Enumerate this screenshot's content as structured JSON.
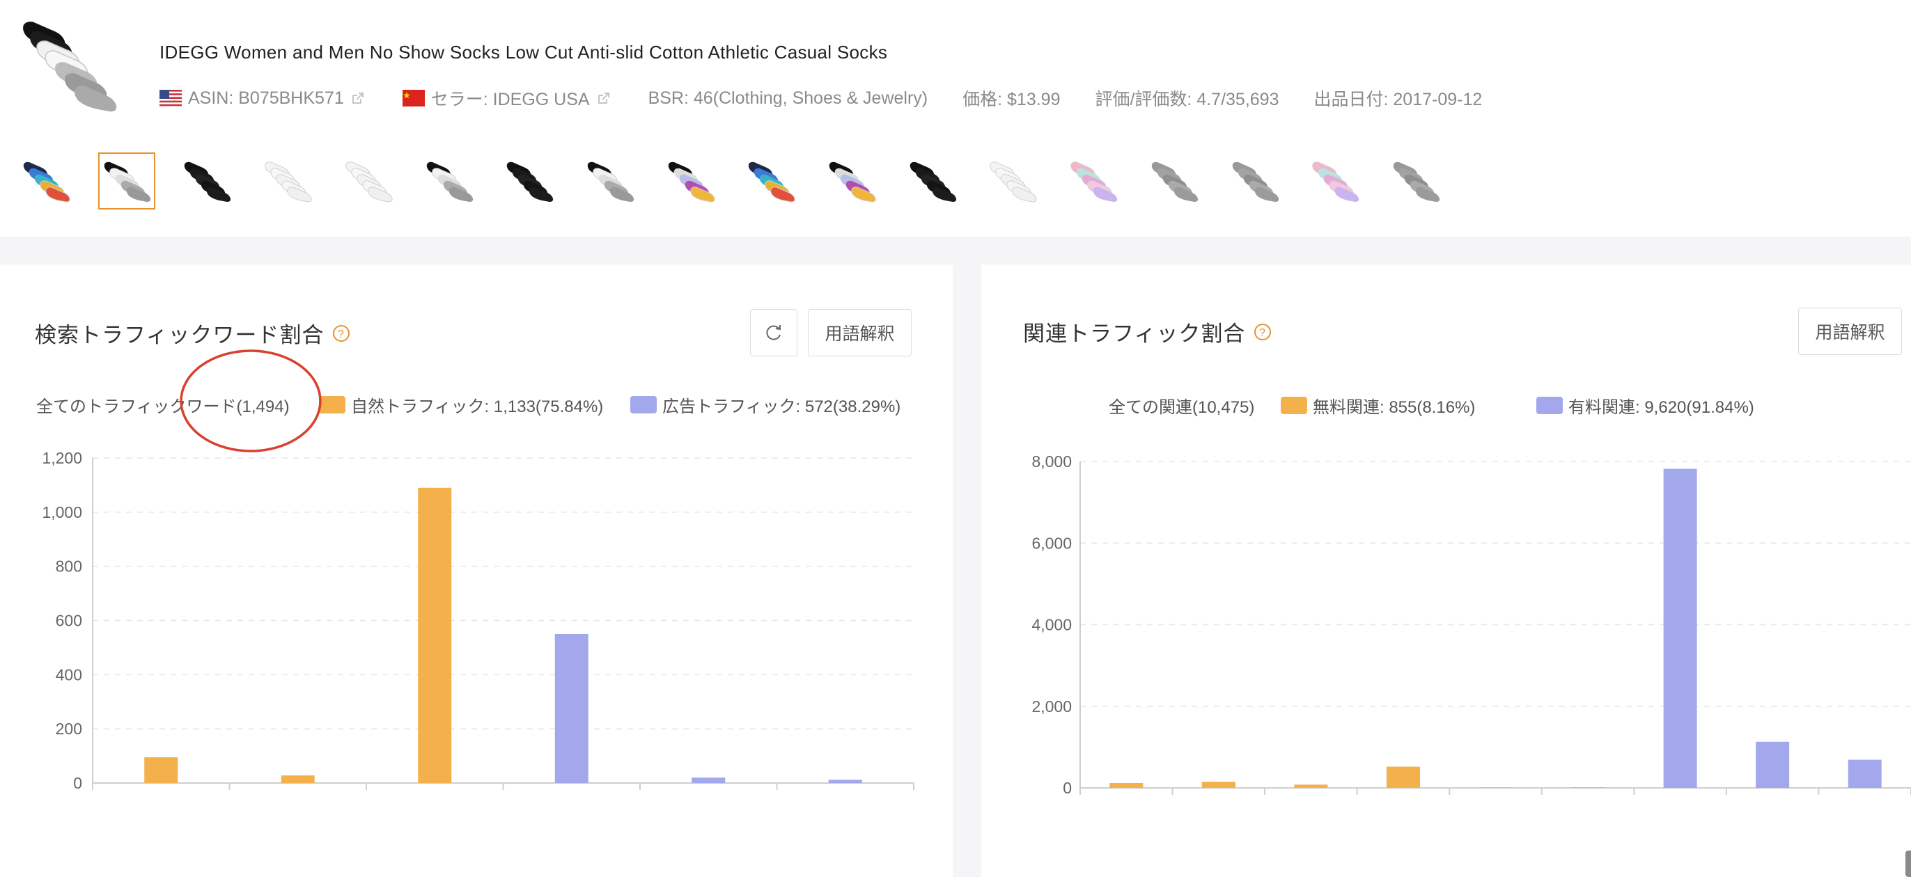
{
  "product": {
    "title": "IDEGG Women and Men No Show Socks Low Cut Anti-slid Cotton Athletic Casual Socks",
    "asin": "ASIN: B075BHK571",
    "seller": "セラー: IDEGG USA",
    "bsr": "BSR: 46(Clothing, Shoes & Jewelry)",
    "price": "価格: $13.99",
    "rating": "評価/評価数: 4.7/35,693",
    "date": "出品日付: 2017-09-12"
  },
  "variants": [
    {
      "icon": "multicolor-socks"
    },
    {
      "icon": "black-white-gray-socks"
    },
    {
      "icon": "black-socks"
    },
    {
      "icon": "white-socks"
    },
    {
      "icon": "white-socks"
    },
    {
      "icon": "black-white-gray-socks"
    },
    {
      "icon": "black-socks"
    },
    {
      "icon": "black-white-gray-socks"
    },
    {
      "icon": "pastel-mix-socks"
    },
    {
      "icon": "multicolor-socks"
    },
    {
      "icon": "pastel-mix-socks"
    },
    {
      "icon": "black-socks"
    },
    {
      "icon": "white-socks"
    },
    {
      "icon": "pink-pastel-socks"
    },
    {
      "icon": "gray-socks"
    },
    {
      "icon": "gray-socks"
    },
    {
      "icon": "pink-pastel-socks"
    },
    {
      "icon": "gray-socks"
    }
  ],
  "search_panel": {
    "title": "検索トラフィックワード割合",
    "glossary_button": "用語解釈",
    "legend_total": "全てのトラフィックワード(1,494)",
    "legend_natural": "自然トラフィック: 1,133(75.84%)",
    "legend_ad": "広告トラフィック: 572(38.29%)"
  },
  "related_panel": {
    "title": "関連トラフィック割合",
    "glossary_button": "用語解釈",
    "legend_total": "全ての関連(10,475)",
    "legend_free": "無料関連: 855(8.16%)",
    "legend_paid": "有料関連: 9,620(91.84%)"
  },
  "colors": {
    "orange": "#f4b04a",
    "purple": "#a3a8ec",
    "accent": "#e8912c",
    "annotation": "#d9412e"
  },
  "chart_data": [
    {
      "type": "bar",
      "ylim": [
        0,
        1200
      ],
      "yticks": [
        "0",
        "200",
        "400",
        "600",
        "800",
        "1,000",
        "1,200"
      ],
      "grid": true,
      "values": [
        95,
        28,
        1090,
        550,
        20,
        12
      ],
      "colors": [
        "#f4b04a",
        "#f4b04a",
        "#f4b04a",
        "#a3a8ec",
        "#a3a8ec",
        "#a3a8ec"
      ]
    },
    {
      "type": "bar",
      "ylim": [
        0,
        8000
      ],
      "yticks": [
        "0",
        "2,000",
        "4,000",
        "6,000",
        "8,000"
      ],
      "grid": true,
      "values": [
        120,
        150,
        80,
        520,
        8,
        15,
        7820,
        1130,
        690
      ],
      "colors": [
        "#f4b04a",
        "#f4b04a",
        "#f4b04a",
        "#f4b04a",
        "#f4b04a",
        "#f4b04a",
        "#a3a8ec",
        "#a3a8ec",
        "#a3a8ec"
      ]
    }
  ]
}
